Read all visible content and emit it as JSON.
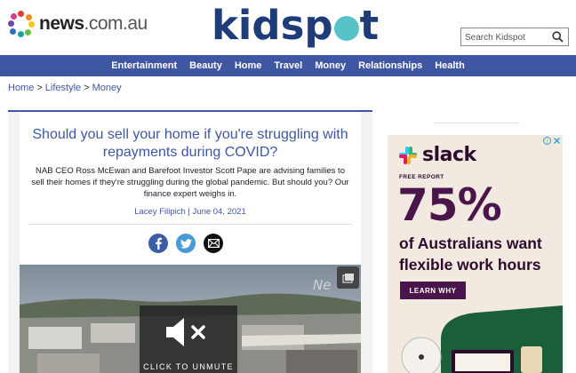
{
  "header": {
    "news_logo_main": "news",
    "news_logo_domain": ".com.au",
    "site_logo": "kidspot",
    "search_placeholder": "Search Kidspot"
  },
  "nav": {
    "items": [
      "Entertainment",
      "Beauty",
      "Home",
      "Travel",
      "Money",
      "Relationships",
      "Health"
    ]
  },
  "breadcrumb": {
    "items": [
      "Home",
      "Lifestyle",
      "Money"
    ],
    "separator": ">"
  },
  "article": {
    "title": "Should you sell your home if you're struggling with repayments during COVID?",
    "standfirst": "NAB CEO Ross McEwan and Barefoot Investor Scott Pape are advising families to sell their homes if they're struggling during the global pandemic. But should you? Our finance expert weighs in.",
    "byline": "Lacey Filipich | June 04, 2021",
    "share_icons": [
      "facebook-icon",
      "twitter-icon",
      "email-icon"
    ],
    "video": {
      "unmute_label": "CLICK TO UNMUTE",
      "watermark": "Ne"
    }
  },
  "ad": {
    "brand": "slack",
    "kicker": "FREE REPORT",
    "stat": "75%",
    "headline": "of Australians want flexible work hours",
    "cta": "LEARN WHY"
  },
  "colors": {
    "brand_blue": "#3f57a3",
    "kidspot_navy": "#1f3c7a",
    "kidspot_teal": "#56c3c9",
    "slack_aubergine": "#4a154b"
  }
}
